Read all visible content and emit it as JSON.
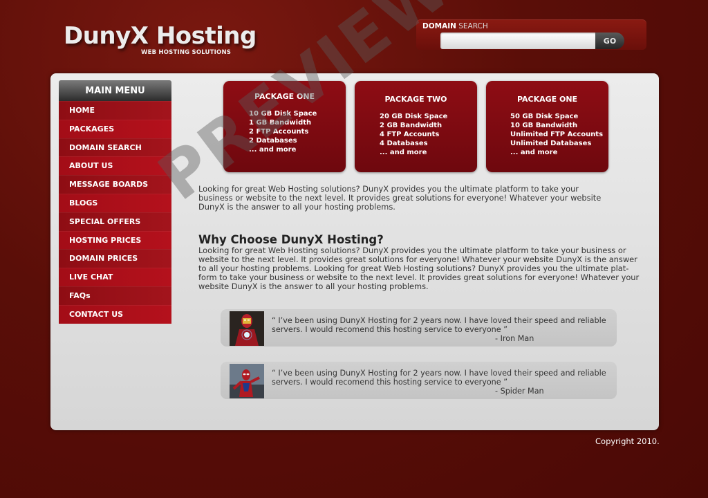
{
  "header": {
    "title": "DunyX Hosting",
    "subtitle": "WEB HOSTING SOLUTIONS"
  },
  "search": {
    "label_bold": "DOMAIN",
    "label_rest": " SEARCH",
    "placeholder": "",
    "button": "GO"
  },
  "menu": {
    "title": "MAIN MENU",
    "items": [
      {
        "label": "HOME"
      },
      {
        "label": "PACKAGES"
      },
      {
        "label": "DOMAIN SEARCH"
      },
      {
        "label": "ABOUT US"
      },
      {
        "label": "MESSAGE BOARDS"
      },
      {
        "label": "BLOGS"
      },
      {
        "label": "SPECIAL OFFERS"
      },
      {
        "label": "HOSTING PRICES"
      },
      {
        "label": "DOMAIN PRICES"
      },
      {
        "label": "LIVE CHAT"
      },
      {
        "label": "FAQs"
      },
      {
        "label": "CONTACT US"
      }
    ]
  },
  "packages": [
    {
      "title": "PACKAGE ONE",
      "features": [
        "10 GB Disk Space",
        "1 GB Bandwidth",
        "2 FTP Accounts",
        "2 Databases",
        "... and more"
      ]
    },
    {
      "title": "PACKAGE TWO",
      "features": [
        "20 GB Disk Space",
        "2 GB Bandwidth",
        "4 FTP Accounts",
        "4 Databases",
        "... and more"
      ]
    },
    {
      "title": "PACKAGE ONE",
      "features": [
        "50 GB Disk Space",
        "10 GB Bandwidth",
        "Unlimited FTP Accounts",
        "Unlimited Databases",
        "... and more"
      ]
    }
  ],
  "intro": "Looking for great Web Hosting solutions? DunyX provides you the ultimate platform to take your business or website to the next level. It provides great solutions for everyone! Whatever your website DunyX is the answer to all your hosting problems.",
  "why": {
    "title_pre": "Why Choose ",
    "title_bold": "DunyX",
    "title_post": " Hosting?",
    "text": "Looking for great Web Hosting solutions? DunyX provides you the ultimate platform to take your business or website to the next level. It provides great solutions for everyone! Whatever your website DunyX is the answer to all your hosting problems. Looking for great Web Hosting solutions? DunyX provides you the ultimate plat-form to take your business or website to the next level. It provides great solutions for everyone! Whatever your website DunyX is the answer to all your hosting problems."
  },
  "testimonials": [
    {
      "quote": "“ I’ve been using DunyX Hosting for 2 years now. I have loved their speed and reliable servers. I would recomend this hosting service to everyone ”",
      "author": "- Iron Man"
    },
    {
      "quote": "“ I’ve been using DunyX Hosting for 2 years now. I have loved their speed and reliable servers. I would recomend this hosting service to everyone ”",
      "author": "- Spider Man"
    }
  ],
  "footer": {
    "copyright": "Copyright 2010."
  },
  "watermark": "PREVIEW",
  "colors": {
    "background": "#5a0e08",
    "accent": "#8e0d14",
    "panel": "#e0e0e0"
  }
}
